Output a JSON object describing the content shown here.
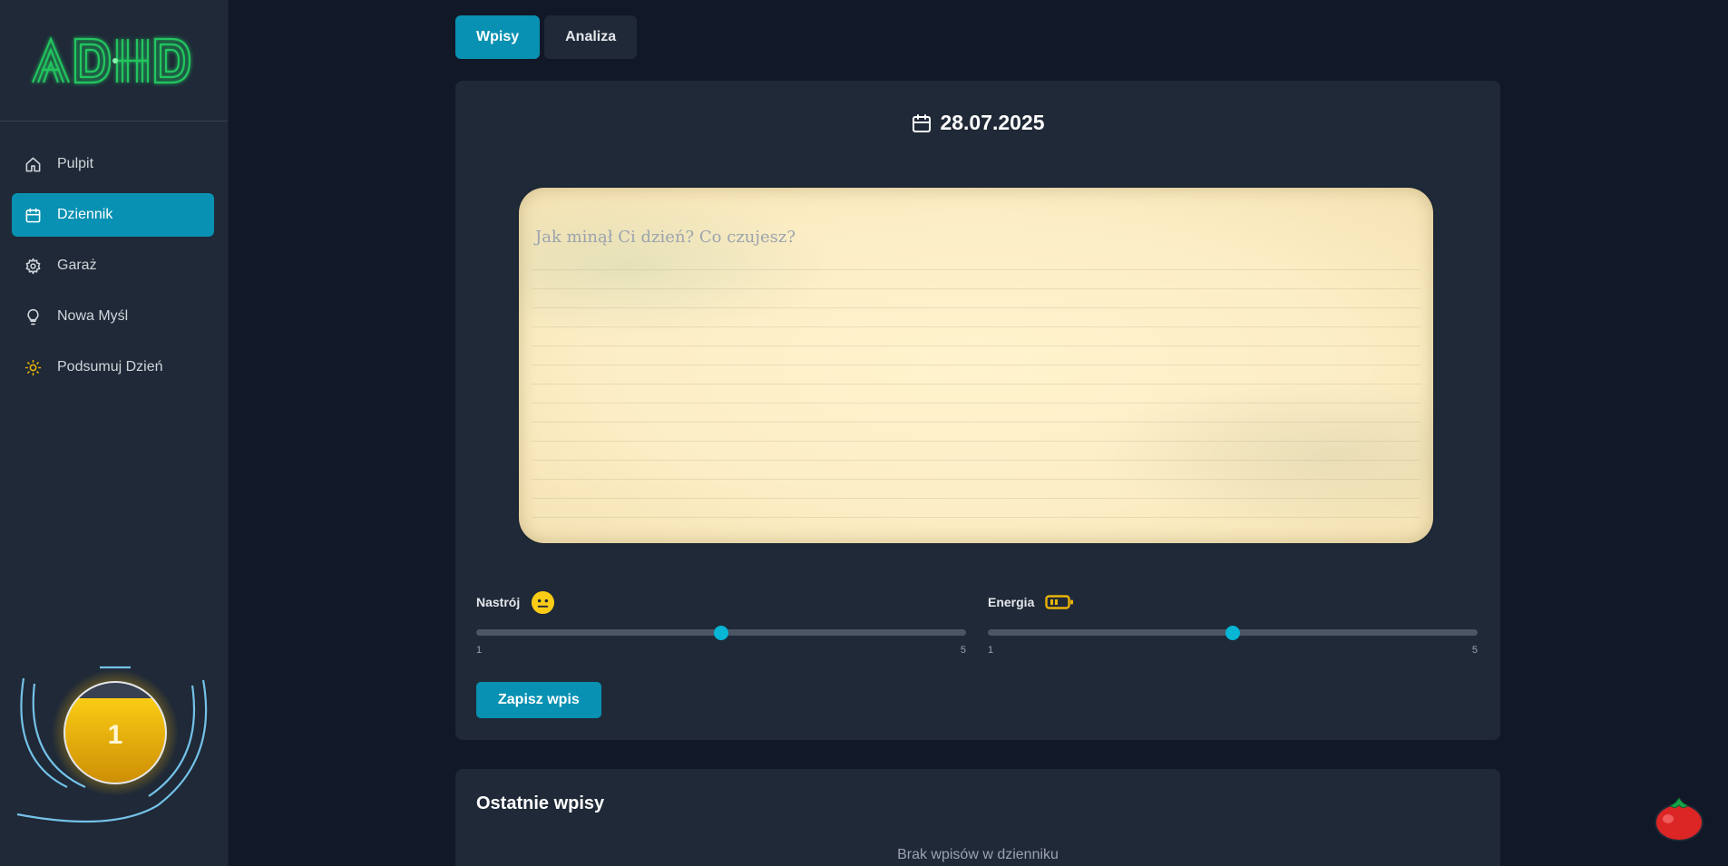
{
  "sidebar": {
    "logo_text": "ADHD",
    "items": [
      {
        "label": "Pulpit",
        "icon": "home-icon"
      },
      {
        "label": "Dziennik",
        "icon": "calendar-icon",
        "active": true
      },
      {
        "label": "Garaż",
        "icon": "gear-icon"
      },
      {
        "label": "Nowa Myśl",
        "icon": "lightbulb-icon"
      },
      {
        "label": "Podsumuj Dzień",
        "icon": "sun-icon"
      }
    ],
    "level": {
      "value": "1",
      "fill": 0.6
    }
  },
  "tabs": [
    {
      "label": "Wpisy",
      "active": true
    },
    {
      "label": "Analiza",
      "active": false
    }
  ],
  "entry": {
    "date": "28.07.2025",
    "placeholder": "Jak minął Ci dzień? Co czujesz?",
    "mood": {
      "label": "Nastrój",
      "min": "1",
      "max": "5",
      "value": 3,
      "icon": "neutral-face-icon"
    },
    "energy": {
      "label": "Energia",
      "min": "1",
      "max": "5",
      "value": 3,
      "icon": "battery-icon"
    },
    "save_label": "Zapisz wpis"
  },
  "recent": {
    "title": "Ostatnie wpisy",
    "empty_text": "Brak wpisów w dzienniku"
  },
  "colors": {
    "accent": "#0891b2",
    "background": "#111827",
    "panel": "#1f2937",
    "logo_green": "#22c55e",
    "gold": "#eab308"
  }
}
